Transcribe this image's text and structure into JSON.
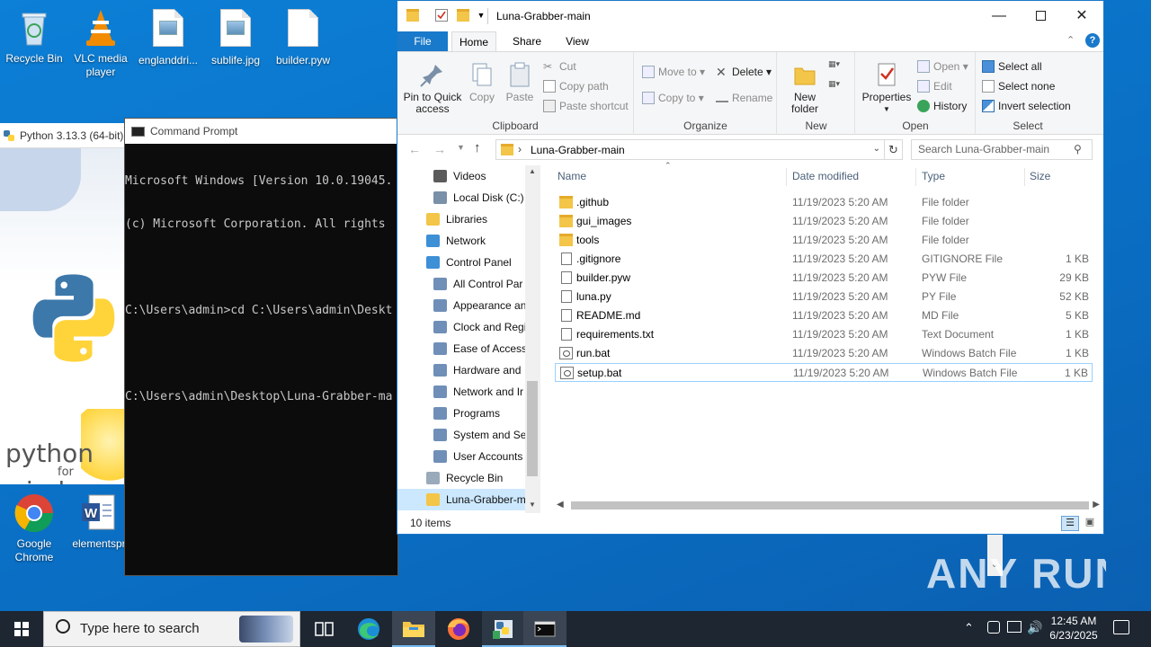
{
  "desktop": {
    "icons": [
      {
        "label": "Recycle Bin",
        "icon": "recycle-bin-icon"
      },
      {
        "label": "VLC media player",
        "icon": "vlc-icon"
      },
      {
        "label": "englanddri...",
        "icon": "image-file-icon"
      },
      {
        "label": "sublife.jpg",
        "icon": "image-file-icon"
      },
      {
        "label": "builder.pyw",
        "icon": "file-icon"
      },
      {
        "label": "Google Chrome",
        "icon": "chrome-icon"
      },
      {
        "label": "elementspr",
        "icon": "word-icon"
      }
    ]
  },
  "python_window": {
    "title": "Python 3.13.3 (64-bit)",
    "splash_text_1": "python",
    "splash_text_2": "for",
    "splash_text_3": "windows"
  },
  "cmd": {
    "title": "Command Prompt",
    "lines": [
      "Microsoft Windows [Version 10.0.19045.",
      "(c) Microsoft Corporation. All rights",
      "",
      "C:\\Users\\admin>cd C:\\Users\\admin\\Deskt",
      "",
      "C:\\Users\\admin\\Desktop\\Luna-Grabber-ma"
    ]
  },
  "explorer": {
    "title": "Luna-Grabber-main",
    "tabs": {
      "file": "File",
      "home": "Home",
      "share": "Share",
      "view": "View"
    },
    "ribbon": {
      "clipboard": {
        "label": "Clipboard",
        "pin": "Pin to Quick access",
        "copy": "Copy",
        "paste": "Paste",
        "cut": "Cut",
        "copy_path": "Copy path",
        "paste_shortcut": "Paste shortcut"
      },
      "organize": {
        "label": "Organize",
        "move_to": "Move to",
        "copy_to": "Copy to",
        "delete": "Delete",
        "rename": "Rename"
      },
      "new": {
        "label": "New",
        "new_folder": "New folder"
      },
      "open": {
        "label": "Open",
        "properties": "Properties",
        "open": "Open",
        "edit": "Edit",
        "history": "History"
      },
      "select": {
        "label": "Select",
        "select_all": "Select all",
        "select_none": "Select none",
        "invert": "Invert selection"
      }
    },
    "address": {
      "path": "Luna-Grabber-main"
    },
    "search": {
      "placeholder": "Search Luna-Grabber-main"
    },
    "nav": [
      {
        "label": "Videos",
        "indent": 2
      },
      {
        "label": "Local Disk (C:)",
        "indent": 2
      },
      {
        "label": "Libraries",
        "indent": 1
      },
      {
        "label": "Network",
        "indent": 1
      },
      {
        "label": "Control Panel",
        "indent": 1
      },
      {
        "label": "All Control Par",
        "indent": 2
      },
      {
        "label": "Appearance an",
        "indent": 2
      },
      {
        "label": "Clock and Regi",
        "indent": 2
      },
      {
        "label": "Ease of Access",
        "indent": 2
      },
      {
        "label": "Hardware and",
        "indent": 2
      },
      {
        "label": "Network and Ir",
        "indent": 2
      },
      {
        "label": "Programs",
        "indent": 2
      },
      {
        "label": "System and Sec",
        "indent": 2
      },
      {
        "label": "User Accounts",
        "indent": 2
      },
      {
        "label": "Recycle Bin",
        "indent": 1
      },
      {
        "label": "Luna-Grabber-m",
        "indent": 1,
        "selected": true
      }
    ],
    "columns": {
      "name": "Name",
      "date": "Date modified",
      "type": "Type",
      "size": "Size"
    },
    "files": [
      {
        "name": ".github",
        "date": "11/19/2023 5:20 AM",
        "type": "File folder",
        "size": "",
        "kind": "folder"
      },
      {
        "name": "gui_images",
        "date": "11/19/2023 5:20 AM",
        "type": "File folder",
        "size": "",
        "kind": "folder"
      },
      {
        "name": "tools",
        "date": "11/19/2023 5:20 AM",
        "type": "File folder",
        "size": "",
        "kind": "folder"
      },
      {
        "name": ".gitignore",
        "date": "11/19/2023 5:20 AM",
        "type": "GITIGNORE File",
        "size": "1 KB",
        "kind": "doc"
      },
      {
        "name": "builder.pyw",
        "date": "11/19/2023 5:20 AM",
        "type": "PYW File",
        "size": "29 KB",
        "kind": "doc"
      },
      {
        "name": "luna.py",
        "date": "11/19/2023 5:20 AM",
        "type": "PY File",
        "size": "52 KB",
        "kind": "doc"
      },
      {
        "name": "README.md",
        "date": "11/19/2023 5:20 AM",
        "type": "MD File",
        "size": "5 KB",
        "kind": "doc"
      },
      {
        "name": "requirements.txt",
        "date": "11/19/2023 5:20 AM",
        "type": "Text Document",
        "size": "1 KB",
        "kind": "doc"
      },
      {
        "name": "run.bat",
        "date": "11/19/2023 5:20 AM",
        "type": "Windows Batch File",
        "size": "1 KB",
        "kind": "bat"
      },
      {
        "name": "setup.bat",
        "date": "11/19/2023 5:20 AM",
        "type": "Windows Batch File",
        "size": "1 KB",
        "kind": "bat",
        "selected": true
      }
    ],
    "status": "10 items"
  },
  "taskbar": {
    "search_placeholder": "Type here to search",
    "time": "12:45 AM",
    "date": "6/23/2025",
    "pinned": [
      "task-view-icon",
      "edge-icon",
      "file-explorer-icon",
      "firefox-icon",
      "python-installer-icon",
      "cmd-icon"
    ]
  },
  "watermark": "ANY RUN",
  "colors": {
    "desktop": "#0c7fd6",
    "accent": "#1979ca",
    "taskbar": "#1d2631"
  }
}
